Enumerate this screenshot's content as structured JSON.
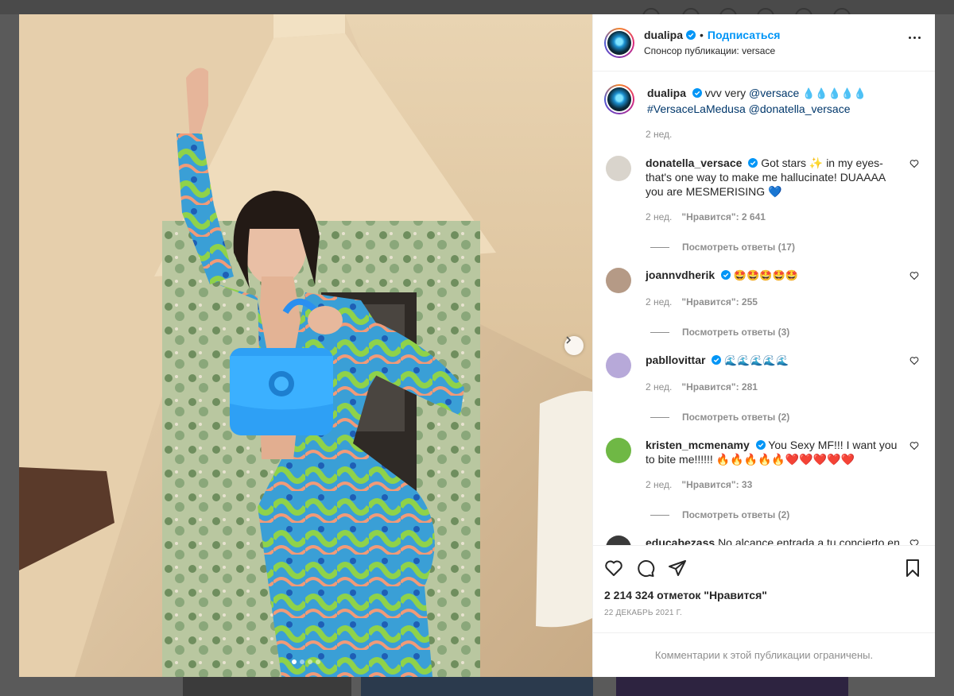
{
  "post": {
    "username": "dualipa",
    "follow_label": "Подписаться",
    "separator": "•",
    "sponsor_prefix": "Спонсор публикации:",
    "sponsor_name": "versace",
    "caption": {
      "username": "dualipa",
      "text_start": "vvv very ",
      "mention": "@versace",
      "emoji": "💧💧💧💧💧",
      "hashtag": "#VersaceLaMedusa",
      "mention2": "@donatella_versace",
      "time": "2 нед."
    }
  },
  "comments": [
    {
      "username": "donatella_versace",
      "verified": true,
      "text": "Got stars ✨ in my eyes- that's one way to make me hallucinate! DUAAAA you are MESMERISING 💙",
      "time": "2 нед.",
      "likes": "\"Нравится\": 2 641",
      "replies": "Посмотреть ответы (17)",
      "avatar_color": "#c9c4bd"
    },
    {
      "username": "joannvdherik",
      "verified": true,
      "text": "🤩🤩🤩🤩🤩",
      "time": "2 нед.",
      "likes": "\"Нравится\": 255",
      "replies": "Посмотреть ответы (3)",
      "avatar_color": "#b59a86"
    },
    {
      "username": "pabllovittar",
      "verified": true,
      "text": "🌊🌊🌊🌊🌊",
      "time": "2 нед.",
      "likes": "\"Нравится\": 281",
      "replies": "Посмотреть ответы (2)",
      "avatar_color": "#b7a9d9"
    },
    {
      "username": "kristen_mcmenamy",
      "verified": true,
      "text": "You Sexy MF!!! I want you to bite me!!!!!! 🔥🔥🔥🔥🔥❤️❤️❤️❤️❤️",
      "time": "2 нед.",
      "likes": "\"Нравится\": 33",
      "replies": "Посмотреть ответы (2)",
      "avatar_color": "#6fb845"
    },
    {
      "username": "educabezass",
      "verified": false,
      "text": "No alcance entrada a tu concierto en",
      "avatar_color": "#3a3a3a"
    }
  ],
  "stats": {
    "likes": "2 214 324 отметок \"Нравится\"",
    "date": "22 ДЕКАБРЬ 2021 Г."
  },
  "comments_restricted": "Комментарии к этой публикации ограничены.",
  "icons": {
    "more": "more-options-icon",
    "like": "heart-icon",
    "comment": "comment-icon",
    "share": "share-icon",
    "save": "bookmark-icon",
    "next": "chevron-right-icon",
    "verified": "verified-badge-icon"
  },
  "colors": {
    "link": "#00376b",
    "follow": "#0095f6",
    "verified": "#0095f6",
    "muted": "#8e8e8e"
  },
  "carousel": {
    "total": 4,
    "active": 1
  }
}
